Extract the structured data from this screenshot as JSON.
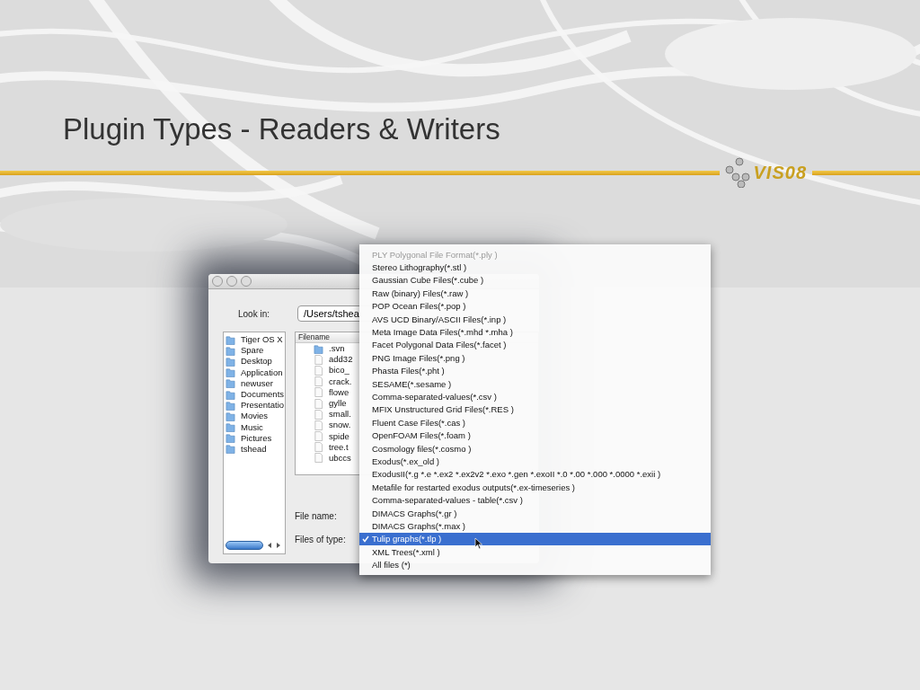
{
  "slide": {
    "title": "Plugin Types - Readers & Writers",
    "logo": {
      "text": "VIS08"
    }
  },
  "dialog": {
    "look_in_label": "Look in:",
    "path": "/Users/tshea",
    "places": [
      "Tiger OS X",
      "Spare",
      "Desktop",
      "Application",
      "newuser",
      "Documents",
      "Presentatio",
      "Movies",
      "Music",
      "Pictures",
      "tshead"
    ],
    "file_list": {
      "header": "Filename",
      "items": [
        {
          "name": ".svn",
          "kind": "folder"
        },
        {
          "name": "add32",
          "kind": "file"
        },
        {
          "name": "bico_",
          "kind": "file"
        },
        {
          "name": "crack.",
          "kind": "file"
        },
        {
          "name": "flowe",
          "kind": "file"
        },
        {
          "name": "gylle",
          "kind": "file"
        },
        {
          "name": "small.",
          "kind": "file"
        },
        {
          "name": "snow.",
          "kind": "file"
        },
        {
          "name": "spide",
          "kind": "file"
        },
        {
          "name": "tree.t",
          "kind": "file"
        },
        {
          "name": "ubccs",
          "kind": "file"
        }
      ]
    },
    "file_name_label": "File name:",
    "file_type_label": "Files of type:",
    "type_menu": [
      {
        "label": "PLY Polygonal File Format(*.ply )",
        "selected": false,
        "dimmed": true
      },
      {
        "label": "Stereo Lithography(*.stl )",
        "selected": false,
        "dimmed": false
      },
      {
        "label": "Gaussian Cube Files(*.cube )",
        "selected": false,
        "dimmed": false
      },
      {
        "label": "Raw (binary) Files(*.raw )",
        "selected": false,
        "dimmed": false
      },
      {
        "label": "POP Ocean Files(*.pop )",
        "selected": false,
        "dimmed": false
      },
      {
        "label": "AVS UCD Binary/ASCII Files(*.inp )",
        "selected": false,
        "dimmed": false
      },
      {
        "label": "Meta Image Data Files(*.mhd *.mha )",
        "selected": false,
        "dimmed": false
      },
      {
        "label": "Facet Polygonal Data Files(*.facet )",
        "selected": false,
        "dimmed": false
      },
      {
        "label": "PNG Image Files(*.png )",
        "selected": false,
        "dimmed": false
      },
      {
        "label": "Phasta Files(*.pht )",
        "selected": false,
        "dimmed": false
      },
      {
        "label": "SESAME(*.sesame )",
        "selected": false,
        "dimmed": false
      },
      {
        "label": "Comma-separated-values(*.csv )",
        "selected": false,
        "dimmed": false
      },
      {
        "label": "MFIX Unstructured Grid Files(*.RES )",
        "selected": false,
        "dimmed": false
      },
      {
        "label": "Fluent Case Files(*.cas )",
        "selected": false,
        "dimmed": false
      },
      {
        "label": "OpenFOAM Files(*.foam )",
        "selected": false,
        "dimmed": false
      },
      {
        "label": "Cosmology files(*.cosmo )",
        "selected": false,
        "dimmed": false
      },
      {
        "label": "Exodus(*.ex_old )",
        "selected": false,
        "dimmed": false
      },
      {
        "label": "ExodusII(*.g *.e *.ex2 *.ex2v2 *.exo *.gen *.exoII *.0 *.00 *.000 *.0000 *.exii )",
        "selected": false,
        "dimmed": false
      },
      {
        "label": "Metafile for restarted exodus outputs(*.ex-timeseries )",
        "selected": false,
        "dimmed": false
      },
      {
        "label": "Comma-separated-values - table(*.csv )",
        "selected": false,
        "dimmed": false
      },
      {
        "label": "DIMACS Graphs(*.gr )",
        "selected": false,
        "dimmed": false
      },
      {
        "label": "DIMACS Graphs(*.max )",
        "selected": false,
        "dimmed": false
      },
      {
        "label": "Tulip graphs(*.tlp )",
        "selected": true,
        "dimmed": false
      },
      {
        "label": "XML Trees(*.xml )",
        "selected": false,
        "dimmed": false
      },
      {
        "label": "All files (*)",
        "selected": false,
        "dimmed": false
      }
    ]
  }
}
